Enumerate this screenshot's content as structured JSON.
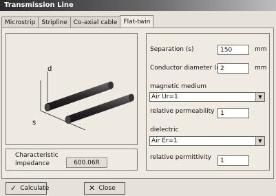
{
  "window": {
    "title": "Transmission Line"
  },
  "tabs": [
    {
      "label": "Microstrip"
    },
    {
      "label": "Stripline"
    },
    {
      "label": "Co-axial cable"
    },
    {
      "label": "Flat-twin"
    }
  ],
  "diagram": {
    "label_d": "d",
    "label_s": "s"
  },
  "form": {
    "separation_label": "Separation (s)",
    "separation_value": "150",
    "separation_unit": "mm",
    "conductor_label": "Conductor diameter (d)",
    "conductor_value": "2",
    "conductor_unit": "mm",
    "magnetic_label": "magnetic medium",
    "magnetic_value": "Air Ur=1",
    "permeability_label": "relative permeability",
    "permeability_value": "1",
    "dielectric_label": "dielectric",
    "dielectric_value": "Air Er=1",
    "permittivity_label": "relative permittivity",
    "permittivity_value": "1"
  },
  "result": {
    "label_line1": "Characteristic",
    "label_line2": "impedance",
    "value": "600.06R"
  },
  "buttons": {
    "calculate": "Calculate",
    "close": "Close",
    "calculate_icon": "check-icon",
    "close_icon": "x-icon"
  }
}
